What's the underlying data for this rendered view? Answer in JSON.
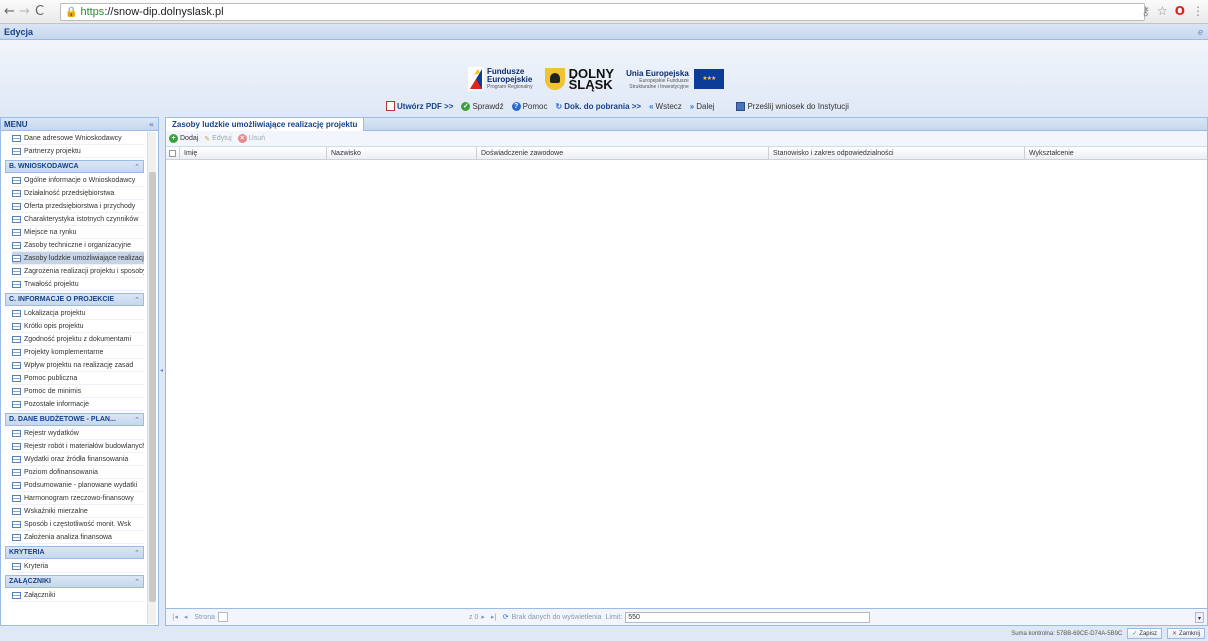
{
  "browser": {
    "url_proto": "https",
    "url_rest": "://snow-dip.dolnyslask.pl"
  },
  "topbar": {
    "title": "Edycja"
  },
  "logos": {
    "fe_line1": "Fundusze",
    "fe_line2": "Europejskie",
    "fe_sub": "Program Regionalny",
    "ds_line1": "DOLNY",
    "ds_line2": "ŚLĄSK",
    "ue_title": "Unia Europejska",
    "ue_sub1": "Europejskie Fundusze",
    "ue_sub2": "Strukturalne i Inwestycyjne"
  },
  "toolbar": {
    "pdf": "Utwórz PDF >>",
    "check": "Sprawdź",
    "help": "Pomoc",
    "docs": "Dok. do pobrania >>",
    "back": "Wstecz",
    "next": "Dalej",
    "send": "Prześlij wniosek do Instytucji"
  },
  "menu": {
    "title": "MENU",
    "items_a": [
      "Dane adresowe Wnioskodawcy",
      "Partnerzy projektu"
    ],
    "sec_b": "B. WNIOSKODAWCA",
    "items_b": [
      "Ogólne informacje o Wnioskodawcy",
      "Działalność przedsiębiorstwa",
      "Oferta przedsiębiorstwa i przychody",
      "Charakterystyka istotnych czynników",
      "Miejsce na rynku",
      "Zasoby techniczne i organizacyjne",
      "Zasoby ludzkie umożliwiające realizację",
      "Zagrożenia realizacji projektu i sposoby",
      "Trwałość projektu"
    ],
    "sec_c": "C. INFORMACJE O PROJEKCIE",
    "items_c": [
      "Lokalizacja projektu",
      "Krótki opis projektu",
      "Zgodność projektu z dokumentami",
      "Projekty komplementarne",
      "Wpływ projektu na realizację zasad",
      "Pomoc publiczna",
      "Pomoc de minimis",
      "Pozostałe informacje"
    ],
    "sec_d": "D. DANE BUDŻETOWE - PLAN...",
    "items_d": [
      "Rejestr wydatków",
      "Rejestr robót i materiałów budowlanych",
      "Wydatki oraz źródła finansowania",
      "Poziom dofinansowania",
      "Podsumowanie - planowane wydatki",
      "Harmonogram rzeczowo-finansowy",
      "Wskaźniki mierzalne",
      "Sposób i częstotliwość monit. Wsk",
      "Założenia analiza finansowa"
    ],
    "sec_k": "KRYTERIA",
    "items_k": [
      "Kryteria"
    ],
    "sec_z": "ZAŁĄCZNIKI",
    "items_z": [
      "Załączniki"
    ]
  },
  "panel": {
    "title": "Zasoby ludzkie umożliwiające realizację projektu",
    "add": "Dodaj",
    "edit": "Edytuj",
    "del": "Usuń",
    "columns": [
      "Imię",
      "Nazwisko",
      "Doświadczenie zawodowe",
      "Stanowisko i zakres odpowiedzialności",
      "Wykształcenie"
    ]
  },
  "pager": {
    "page_label": "Strona",
    "of": "z 0",
    "empty": "Brak danych do wyświetlenia",
    "limit_label": "Limit:",
    "limit": "550"
  },
  "footer": {
    "checksum": "Suma kontrolna: 57BB-69CE-D74A-5B9C",
    "save": "Zapisz",
    "close": "Zamknij"
  }
}
